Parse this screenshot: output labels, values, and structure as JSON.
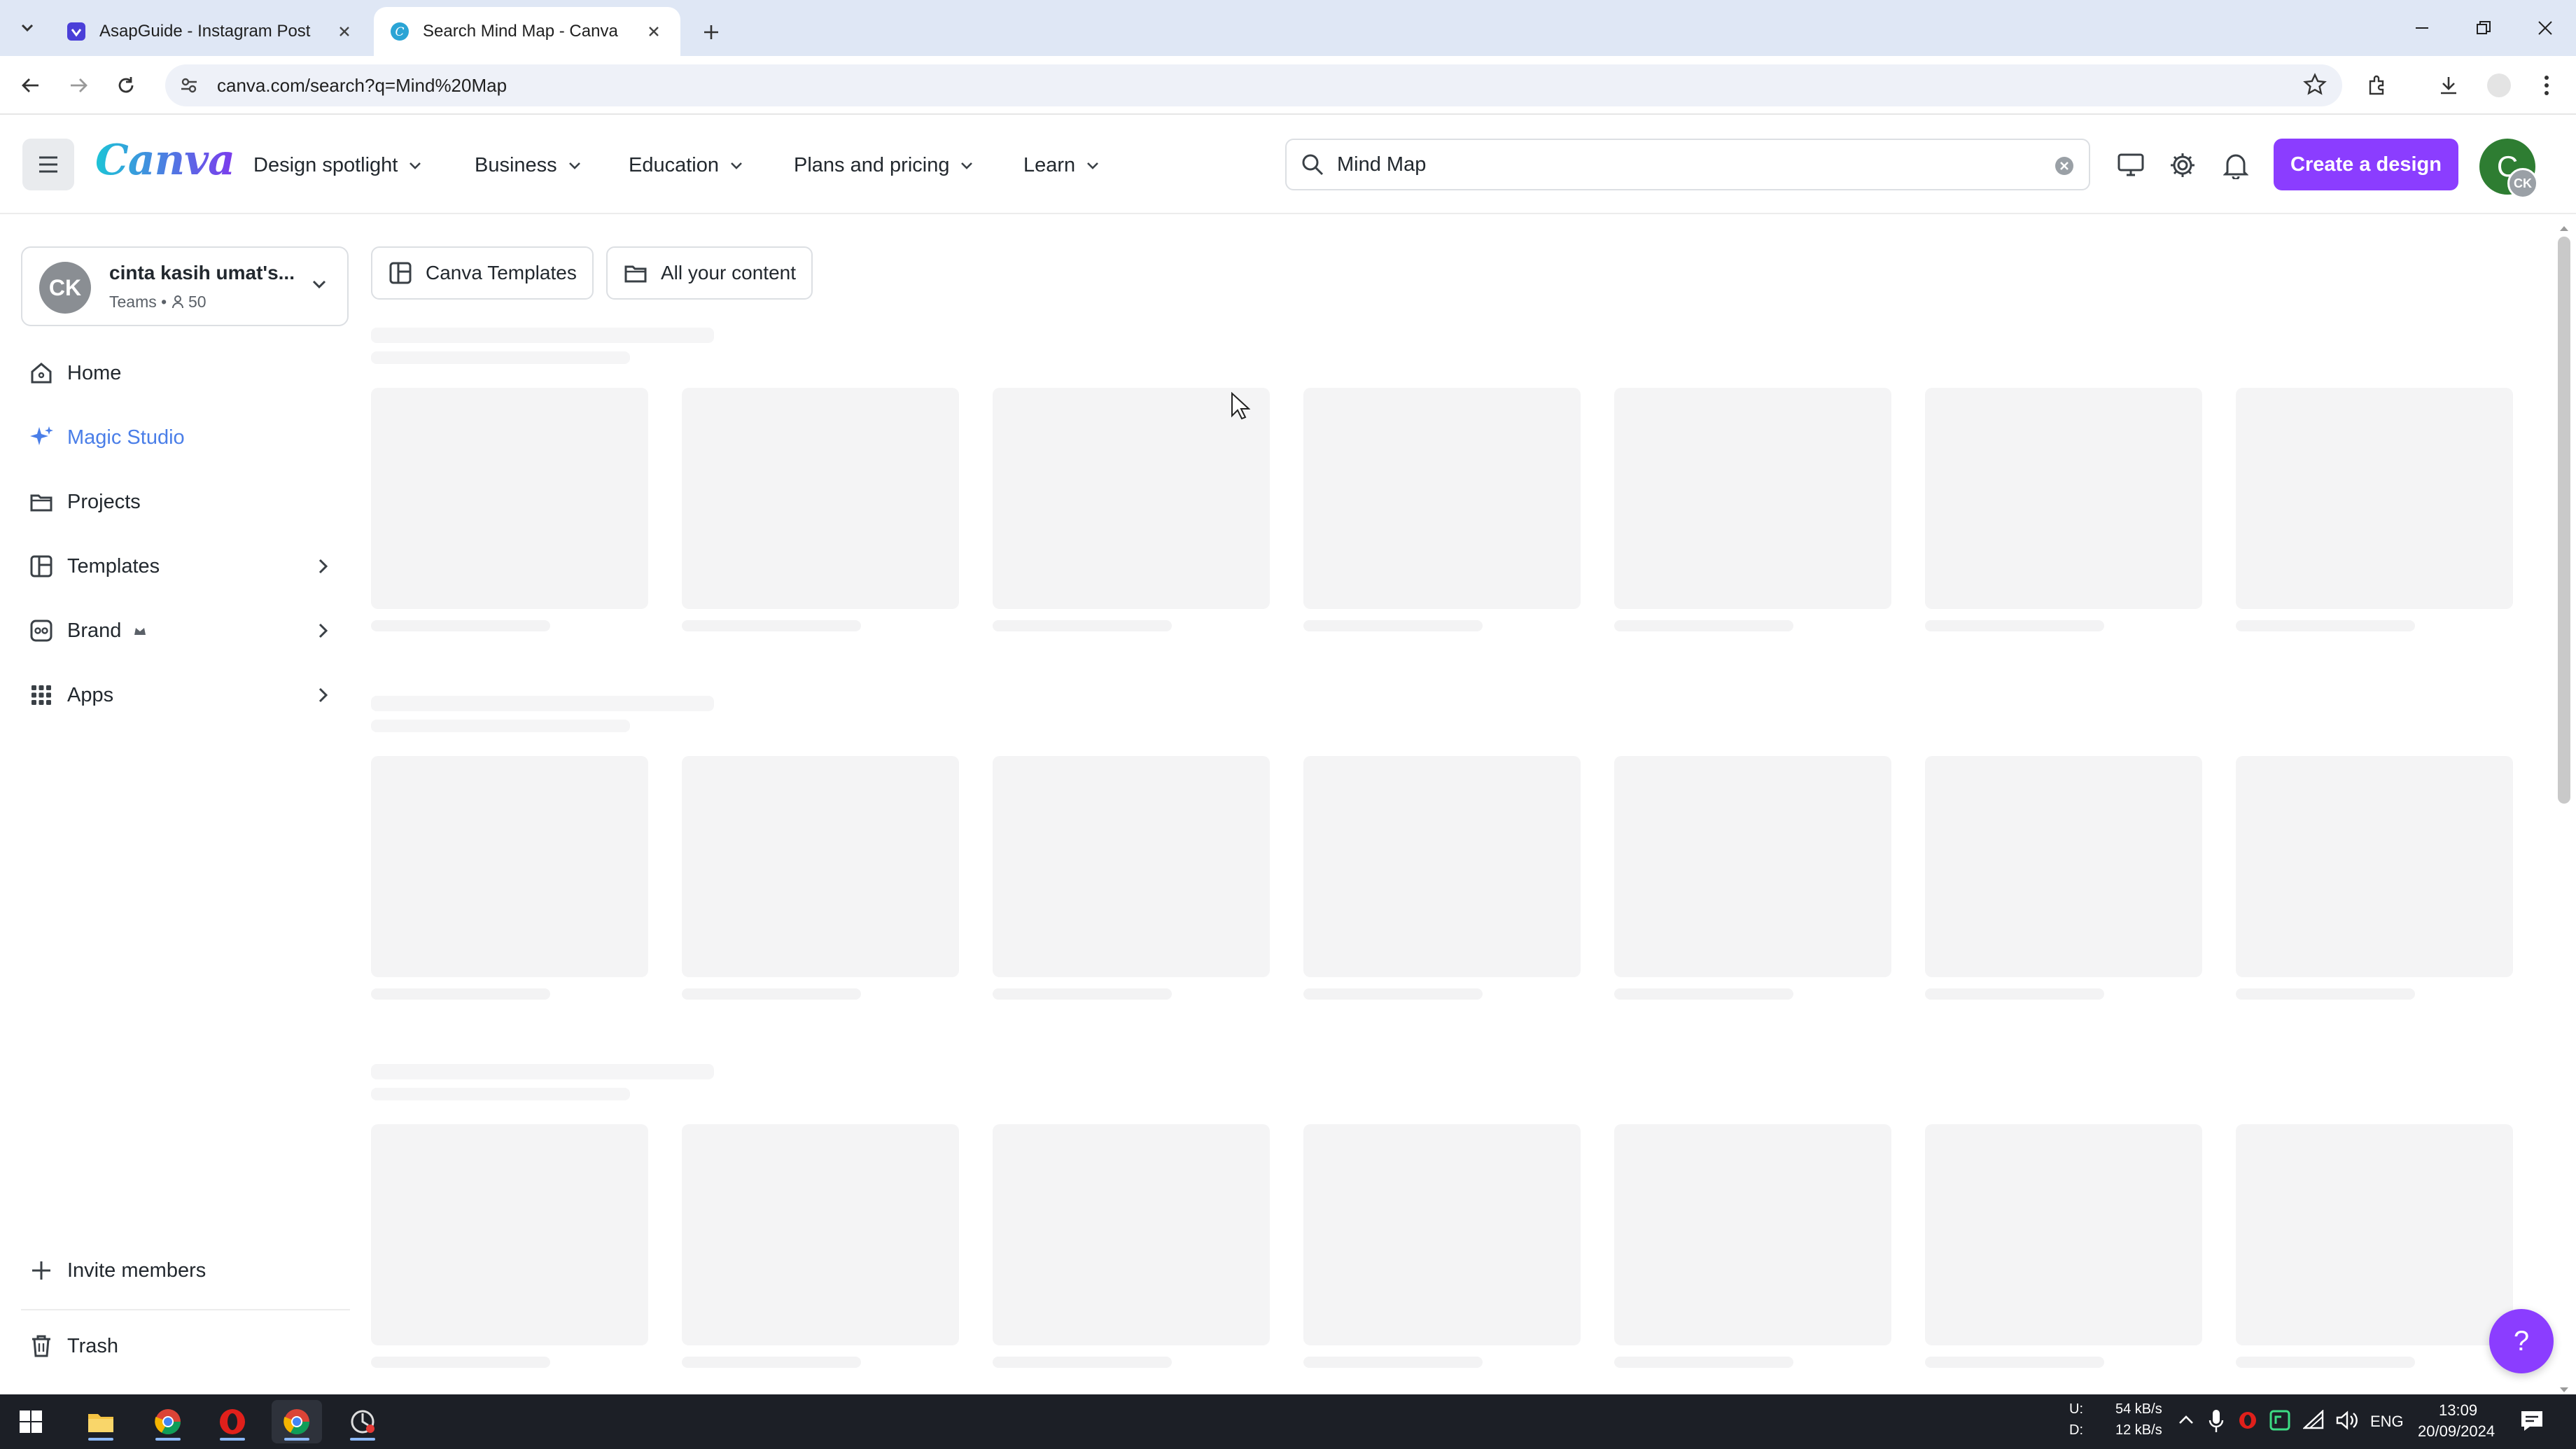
{
  "browser": {
    "tabs": [
      {
        "title": "AsapGuide - Instagram Post",
        "active": false
      },
      {
        "title": "Search Mind Map - Canva",
        "active": true
      }
    ],
    "url": "canva.com/search?q=Mind%20Map"
  },
  "header": {
    "logo": "Canva",
    "nav": [
      {
        "label": "Design spotlight"
      },
      {
        "label": "Business"
      },
      {
        "label": "Education"
      },
      {
        "label": "Plans and pricing"
      },
      {
        "label": "Learn"
      }
    ],
    "search_value": "Mind Map",
    "create_label": "Create a design",
    "avatar_initial": "C",
    "avatar_badge": "CK"
  },
  "sidebar": {
    "team": {
      "initials": "CK",
      "name": "cinta kasih umat's...",
      "plan": "Teams",
      "members": "50"
    },
    "items": [
      {
        "label": "Home",
        "icon": "home-icon"
      },
      {
        "label": "Magic Studio",
        "icon": "sparkle-icon"
      },
      {
        "label": "Projects",
        "icon": "folder-icon"
      },
      {
        "label": "Templates",
        "icon": "template-icon"
      },
      {
        "label": "Brand",
        "icon": "brand-icon"
      },
      {
        "label": "Apps",
        "icon": "apps-grid-icon"
      }
    ],
    "invite_label": "Invite members",
    "trash_label": "Trash"
  },
  "main": {
    "filters": [
      {
        "label": "Canva Templates",
        "icon": "template-icon"
      },
      {
        "label": "All your content",
        "icon": "folder-icon"
      }
    ],
    "loading": true
  },
  "taskbar": {
    "net_up_label": "U:",
    "net_down_label": "D:",
    "net_up": "54 kB/s",
    "net_down": "12 kB/s",
    "lang": "ENG",
    "time": "13:09",
    "date": "20/09/2024"
  },
  "colors": {
    "accent": "#8b3dff",
    "active_nav": "#4a7ee8",
    "skeleton": "#f4f4f5"
  }
}
